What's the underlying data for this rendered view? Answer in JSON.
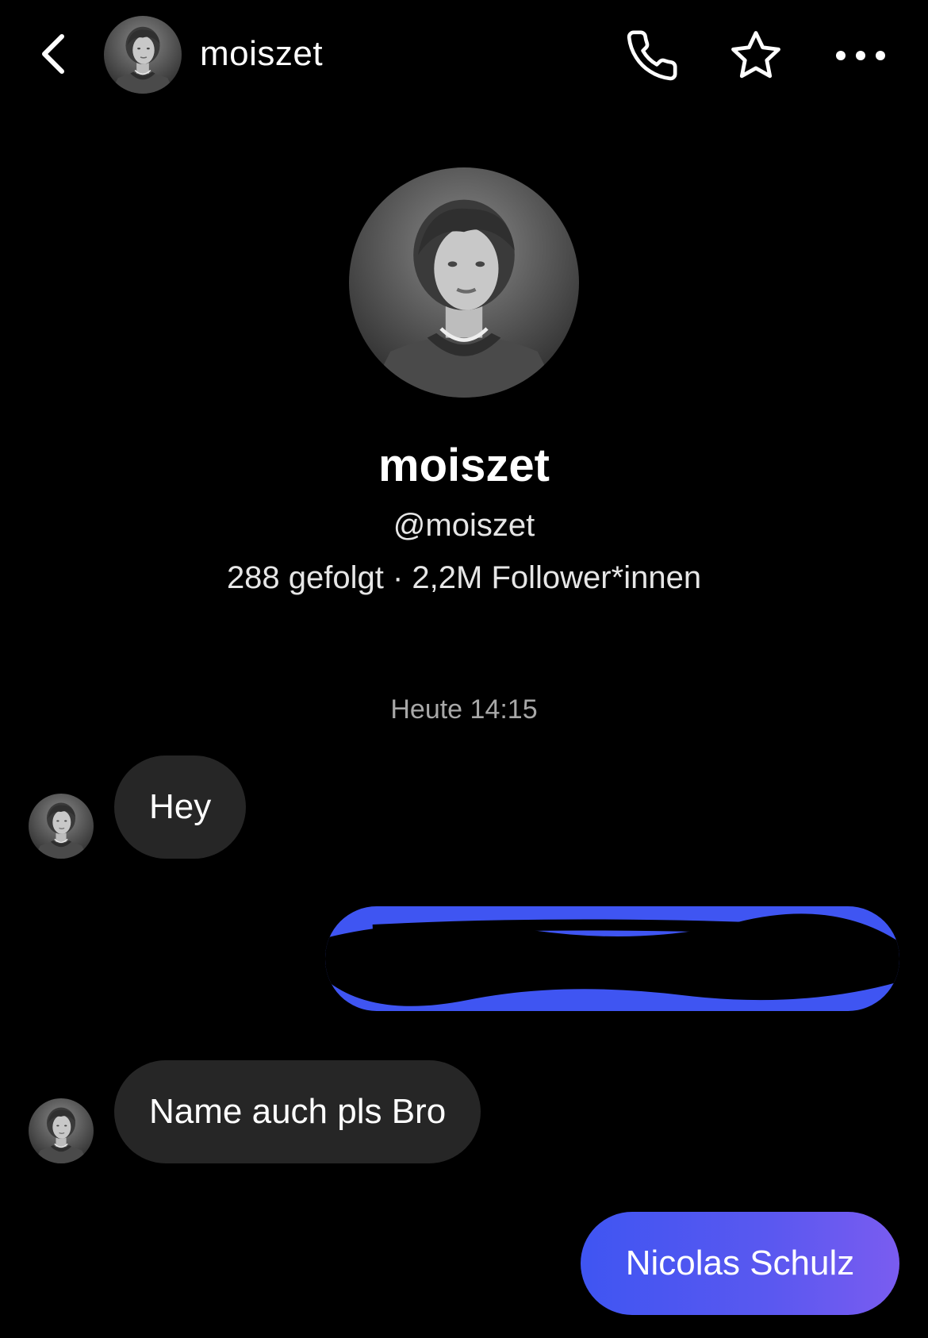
{
  "header": {
    "back_icon": "chevron-left-icon",
    "username": "moiszet",
    "actions": [
      {
        "icon": "phone-icon"
      },
      {
        "icon": "star-outline-icon"
      },
      {
        "icon": "more-horizontal-icon"
      }
    ]
  },
  "profile": {
    "display_name": "moiszet",
    "handle": "@moiszet",
    "stats": "288 gefolgt · 2,2M Follower*innen"
  },
  "conversation": {
    "timestamp": "Heute 14:15",
    "messages": [
      {
        "direction": "incoming",
        "text": "Hey"
      },
      {
        "direction": "outgoing",
        "text": "",
        "redacted": true
      },
      {
        "direction": "incoming",
        "text": "Name auch pls Bro"
      },
      {
        "direction": "outgoing",
        "text": "Nicolas Schulz"
      }
    ]
  },
  "colors": {
    "background": "#000000",
    "incoming_bubble": "#262626",
    "outgoing_bubble": "#3f55f2",
    "outgoing_gradient_end": "#7a5cf0",
    "secondary_text": "#a8a8a8"
  }
}
